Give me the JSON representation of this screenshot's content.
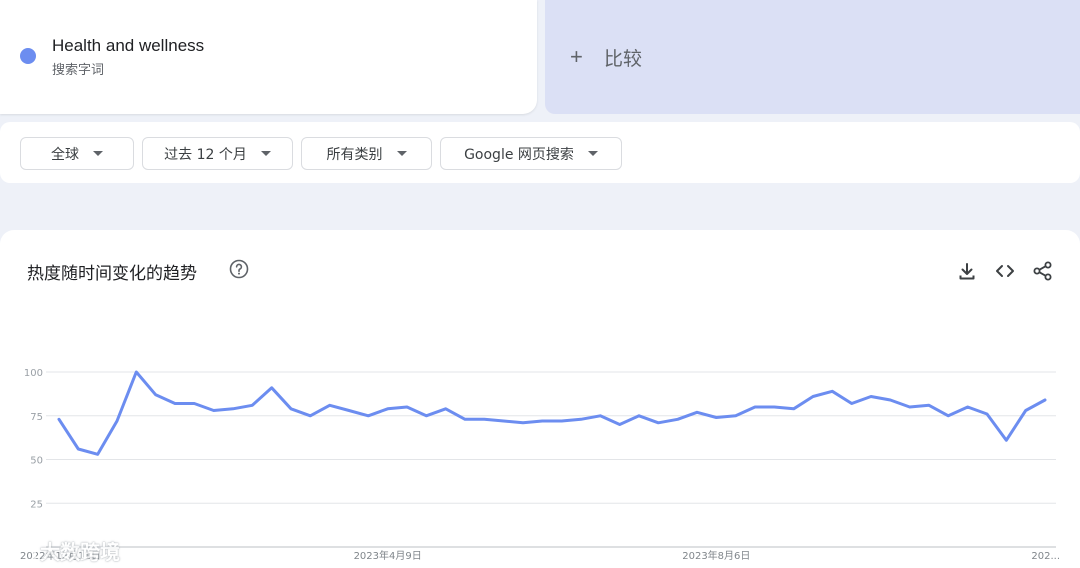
{
  "term": {
    "name": "Health and wellness",
    "subtitle": "搜索字词",
    "color": "#6c8df0"
  },
  "compare": {
    "label": "比较"
  },
  "filters": [
    {
      "label": "全球"
    },
    {
      "label": "过去 12 个月"
    },
    {
      "label": "所有类别"
    },
    {
      "label": "Google 网页搜索"
    }
  ],
  "panel": {
    "title": "热度随时间变化的趋势",
    "tools": {
      "download": "download-icon",
      "embed": "embed-code-icon",
      "share": "share-icon"
    }
  },
  "watermark": {
    "text": "大数跨境"
  },
  "chart_data": {
    "type": "line",
    "yticks": [
      25,
      50,
      75,
      100
    ],
    "ylim": [
      0,
      100
    ],
    "xtick_labels": [
      "2022年12月11日",
      "2023年4月9日",
      "2023年8月6日",
      "202..."
    ],
    "xtick_indices": [
      0,
      17,
      34,
      51
    ],
    "series": [
      {
        "color": "#6c8df0",
        "values": [
          73,
          56,
          53,
          72,
          100,
          87,
          82,
          82,
          78,
          79,
          81,
          91,
          79,
          75,
          81,
          78,
          75,
          79,
          80,
          75,
          79,
          73,
          73,
          72,
          71,
          72,
          72,
          73,
          75,
          70,
          75,
          71,
          73,
          77,
          74,
          75,
          80,
          80,
          79,
          86,
          89,
          82,
          86,
          84,
          80,
          81,
          75,
          80,
          76,
          61,
          78,
          84
        ]
      }
    ]
  }
}
